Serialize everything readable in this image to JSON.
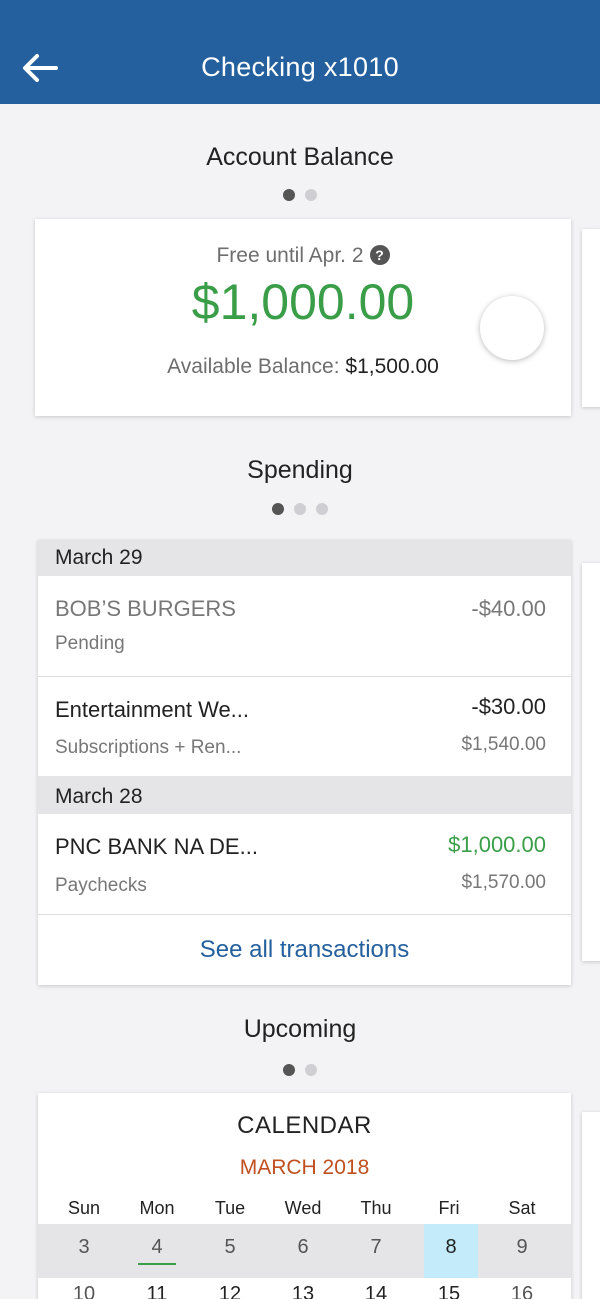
{
  "header": {
    "title": "Checking x1010"
  },
  "balance_section": {
    "title": "Account Balance",
    "free_until": "Free until Apr. 2",
    "help_icon": "?",
    "amount": "$1,000.00",
    "available_label": "Available Balance:",
    "available_value": "$1,500.00",
    "colors": {
      "amount": "#3a9e48"
    }
  },
  "spending": {
    "title": "Spending",
    "groups": [
      {
        "date": "March 29",
        "transactions": [
          {
            "name": "BOB’S BURGERS",
            "amount": "-$40.00",
            "sub": "Pending",
            "balance": ""
          },
          {
            "name": "Entertainment We...",
            "amount": "-$30.00",
            "sub": "Subscriptions + Ren...",
            "balance": "$1,540.00"
          }
        ]
      },
      {
        "date": "March 28",
        "transactions": [
          {
            "name": "PNC BANK NA DE...",
            "amount": "$1,000.00",
            "sub": "Paychecks",
            "balance": "$1,570.00"
          }
        ]
      }
    ],
    "see_all": "See all transactions"
  },
  "upcoming": {
    "title": "Upcoming",
    "calendar": {
      "title": "CALENDAR",
      "month": "MARCH 2018",
      "weekdays": [
        "Sun",
        "Mon",
        "Tue",
        "Wed",
        "Thu",
        "Fri",
        "Sat"
      ],
      "week1": [
        "3",
        "4",
        "5",
        "6",
        "7",
        "8",
        "9"
      ],
      "week2": [
        "10",
        "11",
        "12",
        "13",
        "14",
        "15",
        "16"
      ],
      "today": "4",
      "selected": "8"
    }
  },
  "colors": {
    "header": "#25609e",
    "accent_green": "#3a9e48",
    "month": "#c0501f",
    "selected_day": "#c4ebf9"
  }
}
